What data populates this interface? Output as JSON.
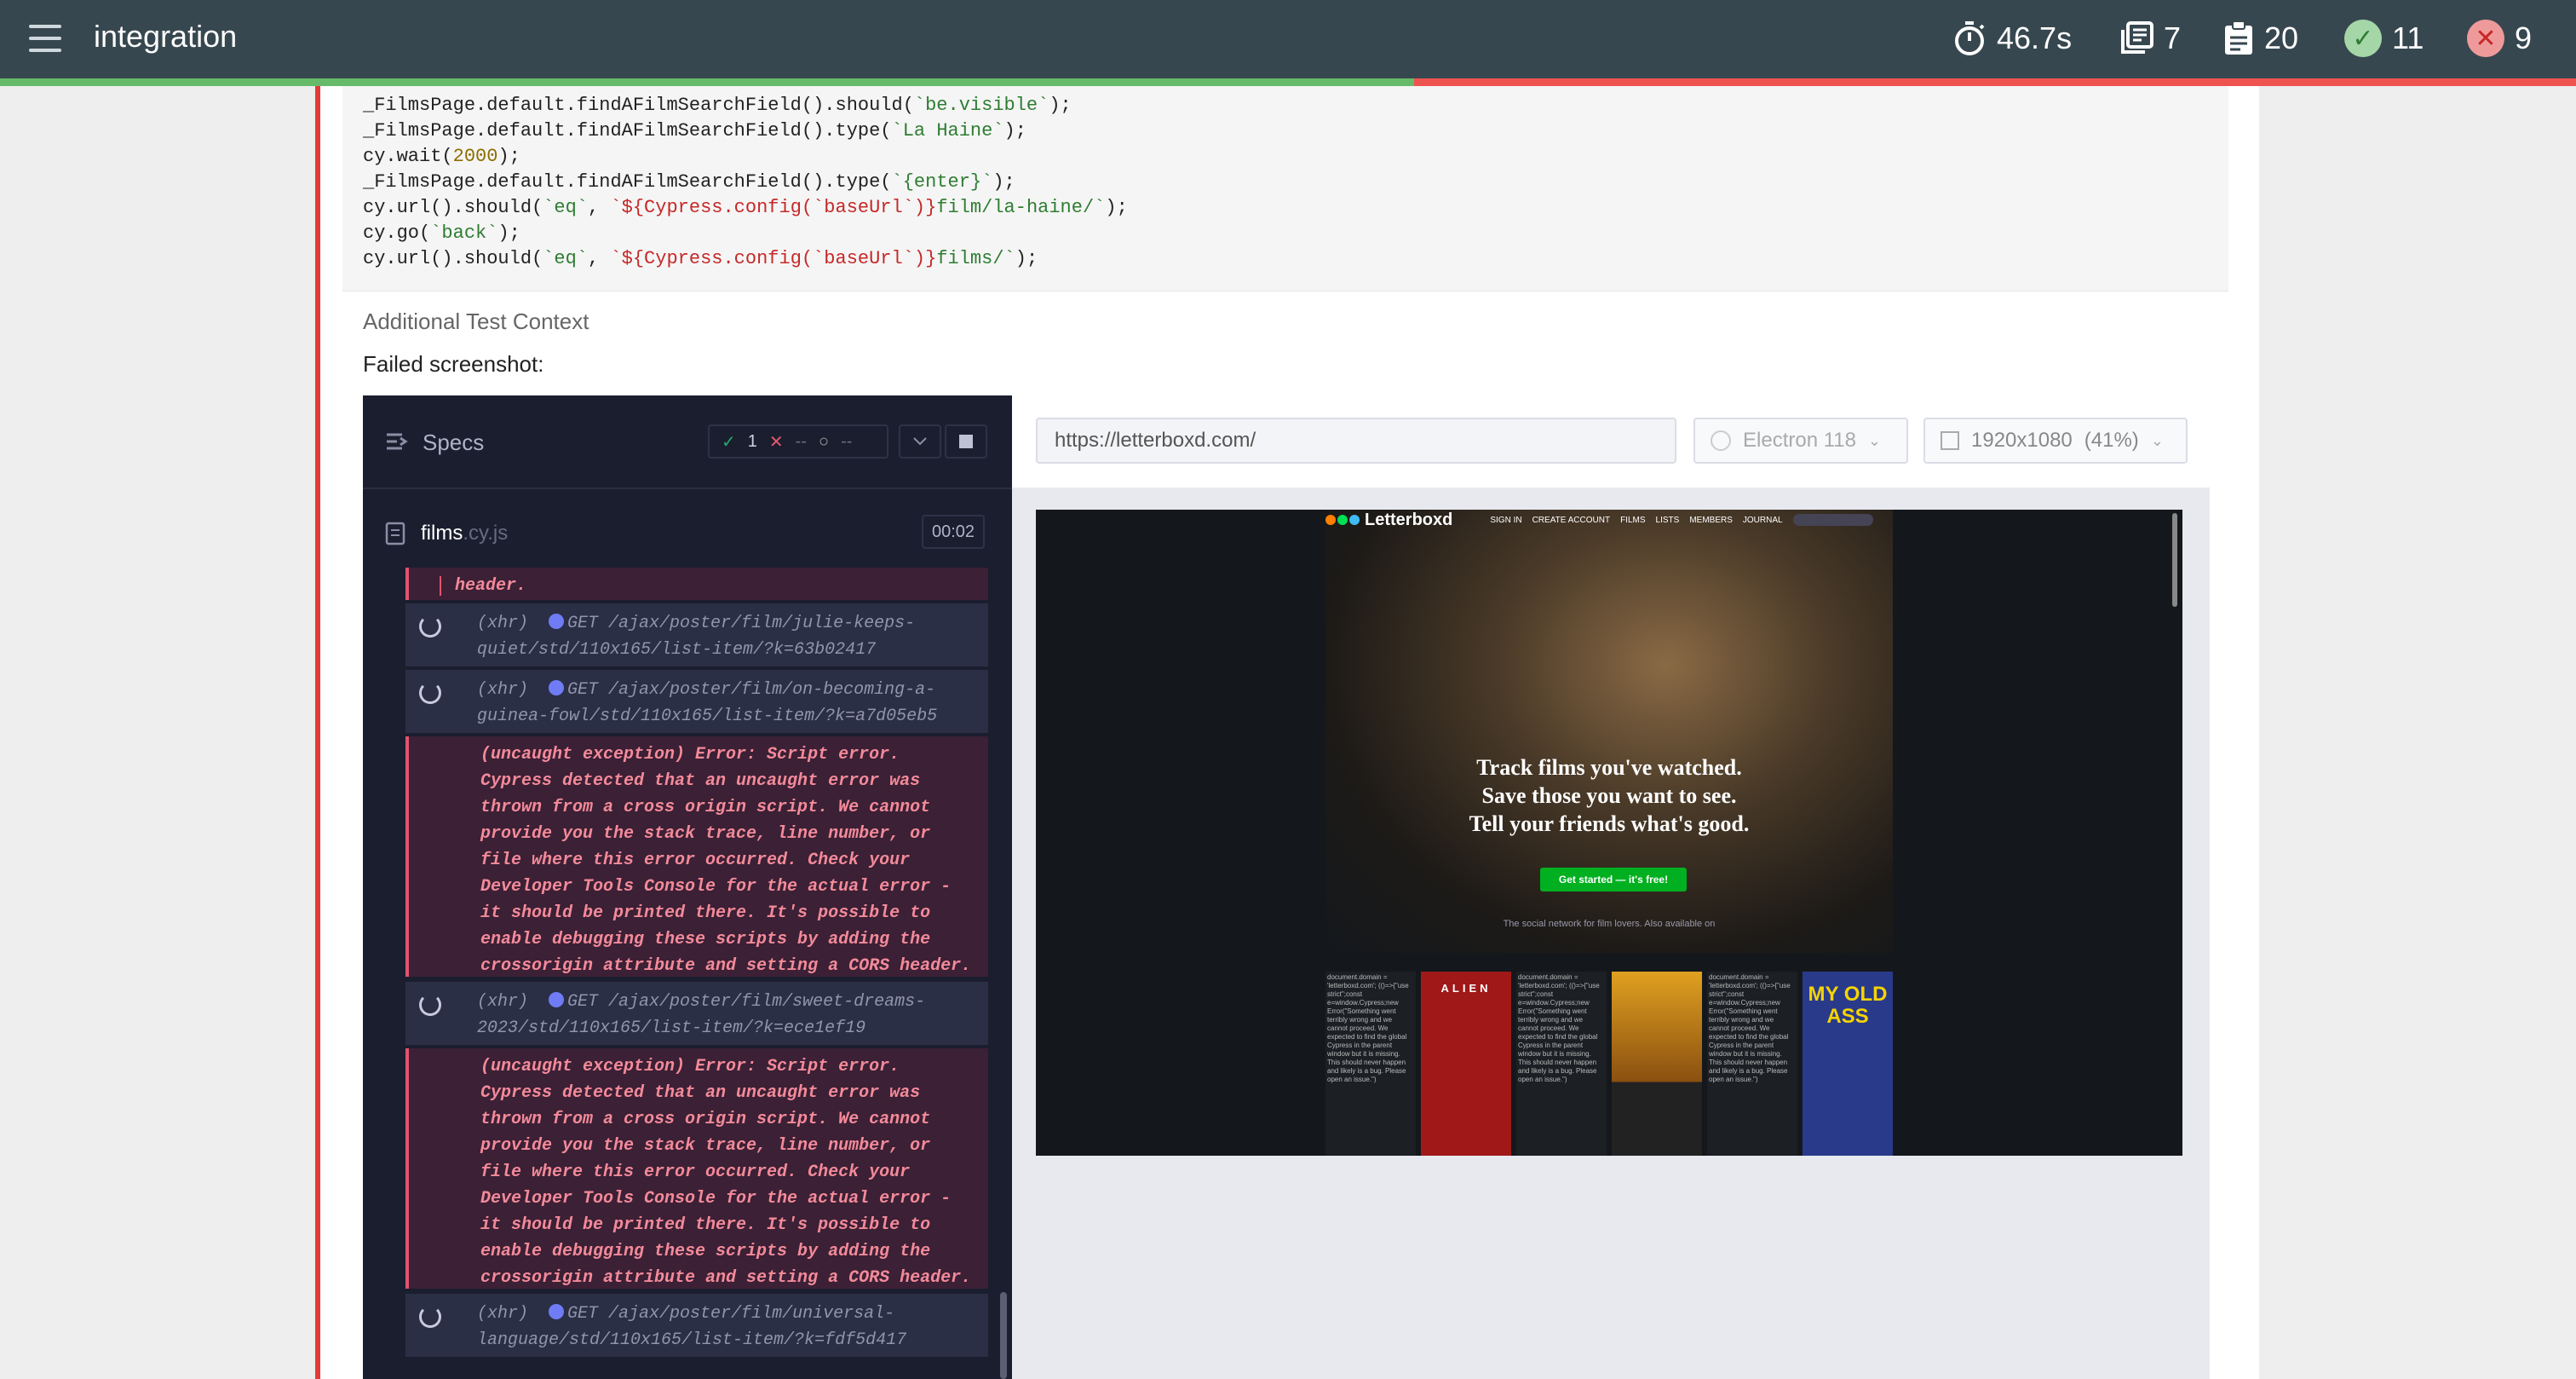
{
  "header": {
    "title": "integration",
    "duration": "46.7s",
    "suites": "7",
    "tests": "20",
    "passed": "11",
    "failed": "9",
    "pass_color": "#66bb6a",
    "fail_color": "#ef5350"
  },
  "code": {
    "lines": [
      "_FilmsPage.default.findAFilmSearchField().should(`be.visible`);",
      "_FilmsPage.default.findAFilmSearchField().type(`La Haine`);",
      "cy.wait(2000);",
      "_FilmsPage.default.findAFilmSearchField().type(`{enter}`);",
      "cy.url().should(`eq`, `${Cypress.config(`baseUrl`)}film/la-haine/`);",
      "cy.go(`back`);",
      "cy.url().should(`eq`, `${Cypress.config(`baseUrl`)}films/`);"
    ]
  },
  "context": {
    "title": "Additional Test Context",
    "failed_label": "Failed screenshot:"
  },
  "runner": {
    "specs_label": "Specs",
    "passed": "1",
    "failed": "--",
    "pending": "--",
    "file_name": "films",
    "file_ext": ".cy.js",
    "file_time": "00:02",
    "commands": [
      {
        "kind": "err",
        "text": "header."
      },
      {
        "kind": "xhr",
        "prefix": "(xhr)",
        "text": "GET /ajax/poster/film/julie-keeps-quiet/std/110x165/list-item/?k=63b02417"
      },
      {
        "kind": "xhr",
        "prefix": "(xhr)",
        "text": "GET /ajax/poster/film/on-becoming-a-guinea-fowl/std/110x165/list-item/?k=a7d05eb5"
      },
      {
        "kind": "err",
        "text": "(uncaught exception)  Error: Script error. Cypress detected that an uncaught error was thrown from a cross origin script. We cannot provide you the stack trace, line number, or file where this error occurred. Check your Developer Tools Console for the actual error - it should be printed there. It's possible to enable debugging these scripts by adding the crossorigin attribute and setting a CORS header."
      },
      {
        "kind": "xhr",
        "prefix": "(xhr)",
        "text": "GET /ajax/poster/film/sweet-dreams-2023/std/110x165/list-item/?k=ece1ef19"
      },
      {
        "kind": "err",
        "text": "(uncaught exception)  Error: Script error. Cypress detected that an uncaught error was thrown from a cross origin script. We cannot provide you the stack trace, line number, or file where this error occurred. Check your Developer Tools Console for the actual error - it should be printed there. It's possible to enable debugging these scripts by adding the crossorigin attribute and setting a CORS header."
      },
      {
        "kind": "xhr",
        "prefix": "(xhr)",
        "text": "GET /ajax/poster/film/universal-language/std/110x165/list-item/?k=fdf5d417"
      }
    ]
  },
  "browser": {
    "url": "https://letterboxd.com/",
    "browser_name": "Electron 118",
    "viewport": "1920x1080",
    "zoom": "(41%)"
  },
  "aut": {
    "logo": "Letterboxd",
    "nav": [
      "SIGN IN",
      "CREATE ACCOUNT",
      "FILMS",
      "LISTS",
      "MEMBERS",
      "JOURNAL"
    ],
    "tagline1": "Track films you've watched.",
    "tagline2": "Save those you want to see.",
    "tagline3": "Tell your friends what's good.",
    "cta": "Get started — it's free!",
    "social": "The social network for film lovers.   Also available on",
    "poster_text": "document.domain = 'letterboxd.com'; (()=>{\"use strict\";const e=window.Cypress;new Error(\"Something went terribly wrong and we cannot proceed. We expected to find the global Cypress in the parent window but it is missing. This should never happen and likely is a bug. Please open an issue.\")",
    "poster1": "ALIEN",
    "poster2": "MY OLD ASS"
  }
}
